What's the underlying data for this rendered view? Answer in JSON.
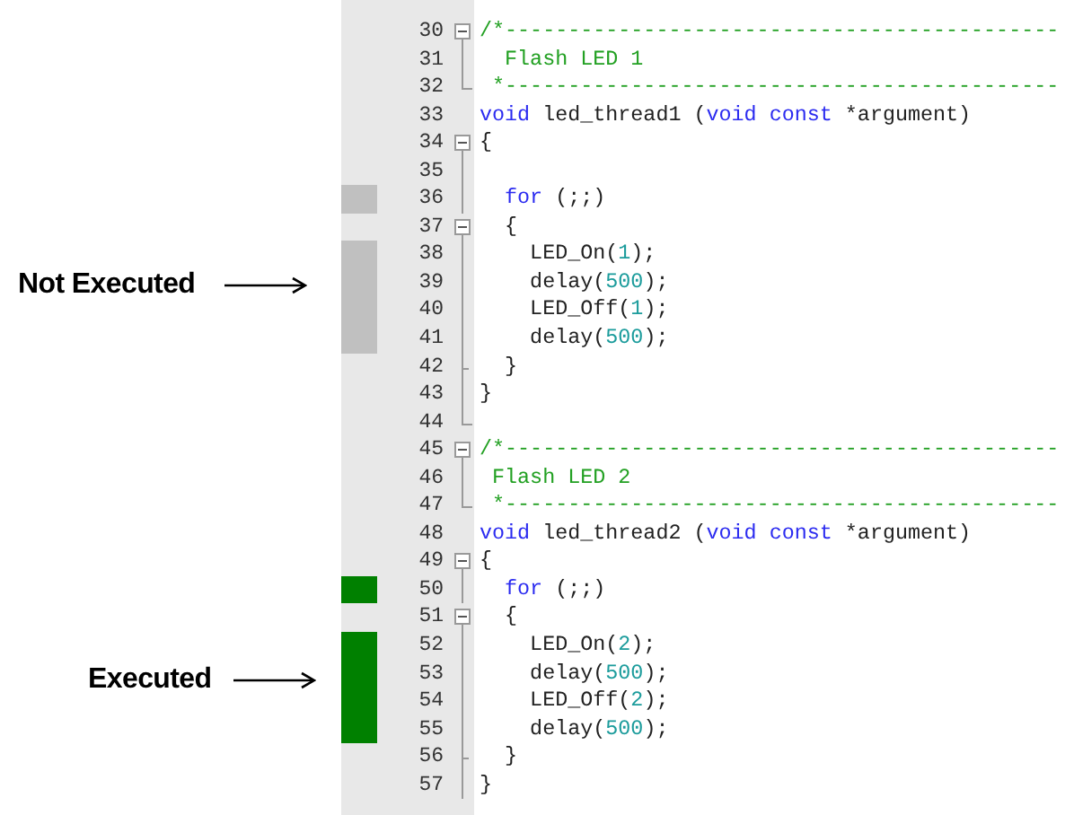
{
  "annotations": [
    {
      "label": "Not Executed",
      "kind": "not_executed"
    },
    {
      "label": "Executed",
      "kind": "executed"
    }
  ],
  "editor": {
    "lines": [
      {
        "number": "30",
        "kind": "fold_start",
        "code": [
          {
            "kind": "comment",
            "text": "/*--------------------------------------------"
          }
        ]
      },
      {
        "number": "31",
        "kind": "fold_line",
        "code": [
          {
            "kind": "comment",
            "text": "  Flash LED 1"
          }
        ]
      },
      {
        "number": "32",
        "kind": "fold_end",
        "code": [
          {
            "kind": "comment",
            "text": " *--------------------------------------------"
          }
        ]
      },
      {
        "number": "33",
        "kind": "plain",
        "code": [
          {
            "kind": "keyword",
            "text": "void"
          },
          {
            "kind": "plain",
            "text": " led_thread1 ("
          },
          {
            "kind": "keyword",
            "text": "void const"
          },
          {
            "kind": "plain",
            "text": " *argument)"
          }
        ]
      },
      {
        "number": "34",
        "kind": "fold_start",
        "code": [
          {
            "kind": "plain",
            "text": "{"
          }
        ]
      },
      {
        "number": "35",
        "kind": "fold_line"
      },
      {
        "number": "36",
        "kind": "fold_line",
        "executed": false,
        "code": [
          {
            "kind": "keyword",
            "text": "  for"
          },
          {
            "kind": "plain",
            "text": " (;;)"
          }
        ]
      },
      {
        "number": "37",
        "kind": "fold_start",
        "code": [
          {
            "kind": "plain",
            "text": "  {"
          }
        ]
      },
      {
        "number": "38",
        "kind": "fold_line",
        "executed": false,
        "code": [
          {
            "kind": "plain",
            "text": "    LED_On("
          },
          {
            "kind": "number",
            "text": "1"
          },
          {
            "kind": "plain",
            "text": ");"
          }
        ]
      },
      {
        "number": "39",
        "kind": "fold_line",
        "executed": false,
        "code": [
          {
            "kind": "plain",
            "text": "    delay("
          },
          {
            "kind": "number",
            "text": "500"
          },
          {
            "kind": "plain",
            "text": ");"
          }
        ]
      },
      {
        "number": "40",
        "kind": "fold_line",
        "executed": false,
        "code": [
          {
            "kind": "plain",
            "text": "    LED_Off("
          },
          {
            "kind": "number",
            "text": "1"
          },
          {
            "kind": "plain",
            "text": ");"
          }
        ]
      },
      {
        "number": "41",
        "kind": "fold_line",
        "executed": false,
        "code": [
          {
            "kind": "plain",
            "text": "    delay("
          },
          {
            "kind": "number",
            "text": "500"
          },
          {
            "kind": "plain",
            "text": ");"
          }
        ]
      },
      {
        "number": "42",
        "kind": "fold_tick",
        "code": [
          {
            "kind": "plain",
            "text": "  }"
          }
        ]
      },
      {
        "number": "43",
        "kind": "fold_line",
        "code": [
          {
            "kind": "plain",
            "text": "}"
          }
        ]
      },
      {
        "number": "44",
        "kind": "fold_end"
      },
      {
        "number": "45",
        "kind": "fold_start",
        "code": [
          {
            "kind": "comment",
            "text": "/*--------------------------------------------"
          }
        ]
      },
      {
        "number": "46",
        "kind": "fold_line",
        "code": [
          {
            "kind": "comment",
            "text": " Flash LED 2"
          }
        ]
      },
      {
        "number": "47",
        "kind": "fold_end",
        "code": [
          {
            "kind": "comment",
            "text": " *--------------------------------------------"
          }
        ]
      },
      {
        "number": "48",
        "kind": "plain",
        "code": [
          {
            "kind": "keyword",
            "text": "void"
          },
          {
            "kind": "plain",
            "text": " led_thread2 ("
          },
          {
            "kind": "keyword",
            "text": "void const"
          },
          {
            "kind": "plain",
            "text": " *argument)"
          }
        ]
      },
      {
        "number": "49",
        "kind": "fold_start",
        "code": [
          {
            "kind": "plain",
            "text": "{"
          }
        ]
      },
      {
        "number": "50",
        "kind": "fold_line",
        "executed": true,
        "code": [
          {
            "kind": "keyword",
            "text": "  for"
          },
          {
            "kind": "plain",
            "text": " (;;)"
          }
        ]
      },
      {
        "number": "51",
        "kind": "fold_start",
        "code": [
          {
            "kind": "plain",
            "text": "  {"
          }
        ]
      },
      {
        "number": "52",
        "kind": "fold_line",
        "executed": true,
        "code": [
          {
            "kind": "plain",
            "text": "    LED_On("
          },
          {
            "kind": "number",
            "text": "2"
          },
          {
            "kind": "plain",
            "text": ");"
          }
        ]
      },
      {
        "number": "53",
        "kind": "fold_line",
        "executed": true,
        "code": [
          {
            "kind": "plain",
            "text": "    delay("
          },
          {
            "kind": "number",
            "text": "500"
          },
          {
            "kind": "plain",
            "text": ");"
          }
        ]
      },
      {
        "number": "54",
        "kind": "fold_line",
        "executed": true,
        "code": [
          {
            "kind": "plain",
            "text": "    LED_Off("
          },
          {
            "kind": "number",
            "text": "2"
          },
          {
            "kind": "plain",
            "text": ");"
          }
        ]
      },
      {
        "number": "55",
        "kind": "fold_line",
        "executed": true,
        "code": [
          {
            "kind": "plain",
            "text": "    delay("
          },
          {
            "kind": "number",
            "text": "500"
          },
          {
            "kind": "plain",
            "text": ");"
          }
        ]
      },
      {
        "number": "56",
        "kind": "fold_tick",
        "code": [
          {
            "kind": "plain",
            "text": "  }"
          }
        ]
      },
      {
        "number": "57",
        "kind": "fold_line",
        "code": [
          {
            "kind": "plain",
            "text": "}"
          }
        ]
      }
    ]
  }
}
